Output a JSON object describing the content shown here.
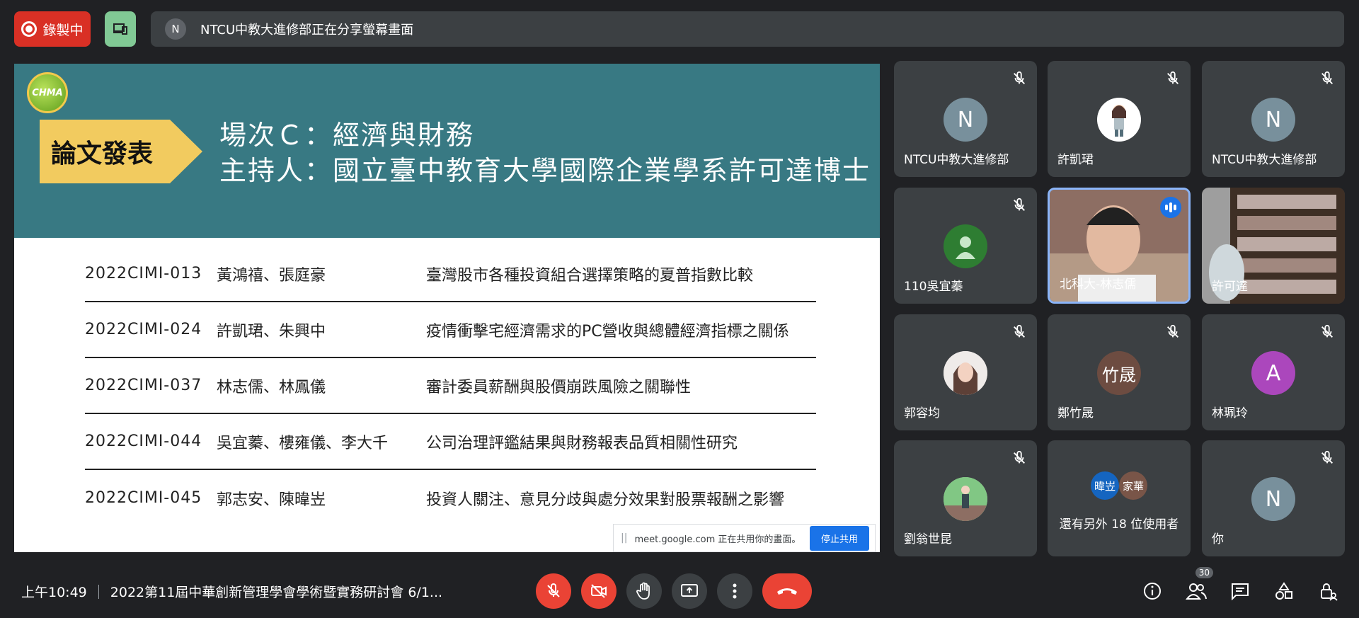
{
  "top_bar": {
    "recording_label": "錄製中",
    "presenter_initial": "N",
    "share_banner_text": "NTCU中教大進修部正在分享螢幕畫面"
  },
  "slide": {
    "logo_text": "CHMA",
    "section_label": "論文發表",
    "title_line1": "場次Ｃ：經濟與財務",
    "title_line2": "主持人：國立臺中教育大學國際企業學系許可達博士",
    "papers": [
      {
        "id": "2022CIMI-013",
        "authors": "黃鴻禧、張庭豪",
        "title": "臺灣股市各種投資組合選擇策略的夏普指數比較"
      },
      {
        "id": "2022CIMI-024",
        "authors": "許凱珺、朱興中",
        "title": "疫情衝擊宅經濟需求的PC營收與總體經濟指標之關係"
      },
      {
        "id": "2022CIMI-037",
        "authors": "林志儒、林鳳儀",
        "title": "審計委員薪酬與股價崩跌風險之關聯性"
      },
      {
        "id": "2022CIMI-044",
        "authors": "吳宜蓁、樓雍儀、李大千",
        "title": "公司治理評鑑結果與財務報表品質相關性研究"
      },
      {
        "id": "2022CIMI-045",
        "authors": "郭志安、陳暐岦",
        "title": "投資人關注、意見分歧與處分效果對股票報酬之影響"
      }
    ],
    "share_notice_text": "meet.google.com 正在共用你的畫面。",
    "stop_share_label": "停止共用"
  },
  "participants": [
    {
      "name": "NTCU中教大進修部",
      "initial": "N",
      "avatar_color": "#78909c"
    },
    {
      "name": "許凱珺",
      "initial": "",
      "avatar_color": "#ffffff"
    },
    {
      "name": "NTCU中教大進修部",
      "initial": "N",
      "avatar_color": "#78909c"
    },
    {
      "name": "110吳宜蓁",
      "initial": "",
      "avatar_color": "#2e7d32"
    },
    {
      "name": "北科大-林志儒",
      "initial": "",
      "avatar_color": ""
    },
    {
      "name": "許可達",
      "initial": "",
      "avatar_color": ""
    },
    {
      "name": "郭容均",
      "initial": "",
      "avatar_color": "#d7ccc8"
    },
    {
      "name": "鄭竹晟",
      "initial": "竹晟",
      "avatar_color": "#6d4c41"
    },
    {
      "name": "林珮玲",
      "initial": "A",
      "avatar_color": "#ab47bc"
    },
    {
      "name": "劉翁世昆",
      "initial": "",
      "avatar_color": "#a5d6a7"
    },
    {
      "name": "還有另外 18 位使用者",
      "initials": [
        "暐岦",
        "家華"
      ],
      "avatar_colors": [
        "#1565c0",
        "#795548"
      ]
    },
    {
      "name": "你",
      "initial": "N",
      "avatar_color": "#78909c"
    }
  ],
  "bottom_bar": {
    "time": "上午10:49",
    "meeting_title": "2022第11屆中華創新管理學會學術暨實務研討會 6/1...",
    "participant_count": "30"
  },
  "colors": {
    "recording_red": "#d93025",
    "slide_header_teal": "#387983",
    "label_yellow": "#f2cb5f",
    "end_call_red": "#ea4335",
    "accent_blue": "#1a73e8"
  }
}
